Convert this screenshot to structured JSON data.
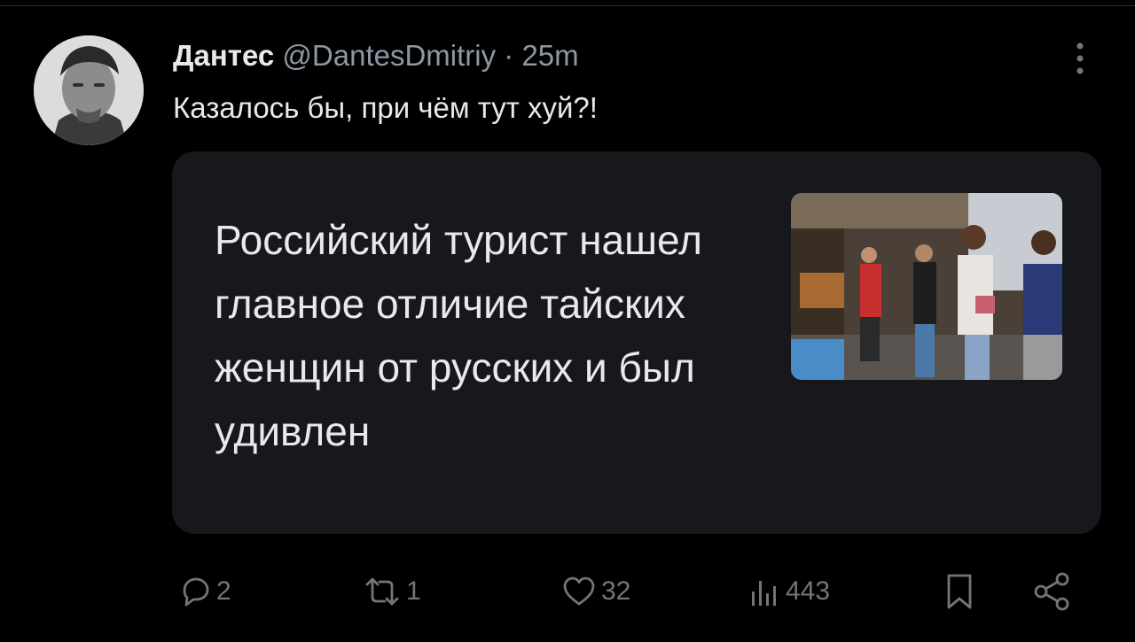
{
  "author": {
    "name": "Дантес",
    "handle": "@DantesDmitriy",
    "separator": "·",
    "time": "25m"
  },
  "tweet": {
    "text": "Казалось бы, при чём тут хуй?!"
  },
  "card": {
    "title": "Российский турист нашел главное отличие тайских женщин от русских и был удивлен"
  },
  "actions": {
    "replies": "2",
    "reposts": "1",
    "likes": "32",
    "views": "443"
  },
  "icons": {
    "more": "more-vertical-icon",
    "reply": "reply-bubble-icon",
    "repost": "repost-arrows-icon",
    "like": "heart-icon",
    "views": "bar-chart-icon",
    "bookmark": "bookmark-icon",
    "share": "share-icon"
  },
  "colors": {
    "background": "#000000",
    "text": "#e7e9ea",
    "muted": "#71767b",
    "card": "#16181c"
  }
}
